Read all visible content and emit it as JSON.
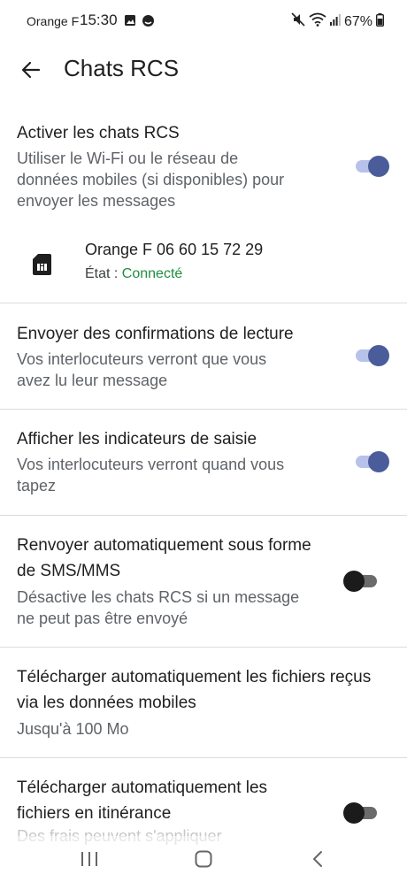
{
  "status": {
    "carrier": "Orange F",
    "time": "15:30",
    "battery": "67%"
  },
  "header": {
    "title": "Chats RCS"
  },
  "settings": [
    {
      "title": "Activer les chats RCS",
      "subtitle_lines": [
        "Utiliser le Wi-Fi ou le réseau de",
        "données mobiles (si disponibles) pour",
        "envoyer les messages"
      ],
      "toggle": true
    },
    {
      "title": "Envoyer des confirmations de lecture",
      "subtitle_lines": [
        "Vos interlocuteurs verront que vous",
        "avez lu leur message"
      ],
      "toggle": true
    },
    {
      "title": "Afficher les indicateurs de saisie",
      "subtitle_lines": [
        "Vos interlocuteurs verront quand vous",
        "tapez"
      ],
      "toggle": true
    },
    {
      "title_lines": [
        "Renvoyer automatiquement sous forme",
        "de SMS/MMS"
      ],
      "subtitle_lines": [
        "Désactive les chats RCS si un message",
        "ne peut pas être envoyé"
      ],
      "toggle": false
    },
    {
      "title_lines": [
        "Télécharger automatiquement les fichiers reçus",
        "via les données mobiles"
      ],
      "subtitle_lines": [
        "Jusqu'à 100 Mo"
      ]
    },
    {
      "title_lines": [
        "Télécharger automatiquement les",
        "fichiers en itinérance"
      ],
      "subtitle_lines": [
        "Des frais peuvent s'appliquer"
      ],
      "toggle": false
    }
  ],
  "sim": {
    "number": "Orange F 06 60 15 72 29",
    "state_label": "État : ",
    "state_value": "Connecté"
  },
  "colors": {
    "toggle_on_thumb": "#4a5c9a",
    "toggle_on_track": "#b6c2ea",
    "connected_green": "#1e8e3e"
  },
  "icons": [
    "back-arrow-icon",
    "sim-card-icon",
    "mute-icon",
    "wifi-icon",
    "signal-icon",
    "battery-icon",
    "recent-apps-icon",
    "home-icon",
    "back-nav-icon"
  ]
}
